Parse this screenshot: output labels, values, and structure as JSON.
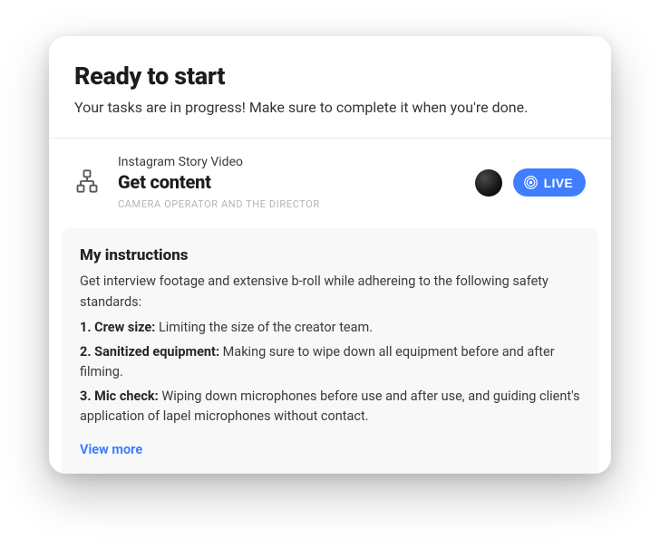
{
  "header": {
    "title": "Ready to start",
    "subtitle": "Your tasks are in progress! Make sure to complete it when you're done."
  },
  "task": {
    "eyebrow": "Instagram Story Video",
    "title": "Get content",
    "role": "CAMERA OPERATOR AND THE DIRECTOR",
    "live_label": "LIVE"
  },
  "instructions": {
    "title": "My instructions",
    "lead": "Get interview footage and extensive b-roll while adhereing to the following safety standards:",
    "items": [
      {
        "num": "1.",
        "label": "Crew size:",
        "text": " Limiting the size of the creator team."
      },
      {
        "num": "2.",
        "label": "Sanitized equipment:",
        "text": " Making sure to wipe down all equipment before and after filming."
      },
      {
        "num": "3.",
        "label": "Mic check:",
        "text": " Wiping down microphones before use and after use, and guiding client's application of lapel microphones without contact."
      }
    ],
    "view_more": "View more"
  },
  "colors": {
    "accent": "#3f7fff"
  }
}
